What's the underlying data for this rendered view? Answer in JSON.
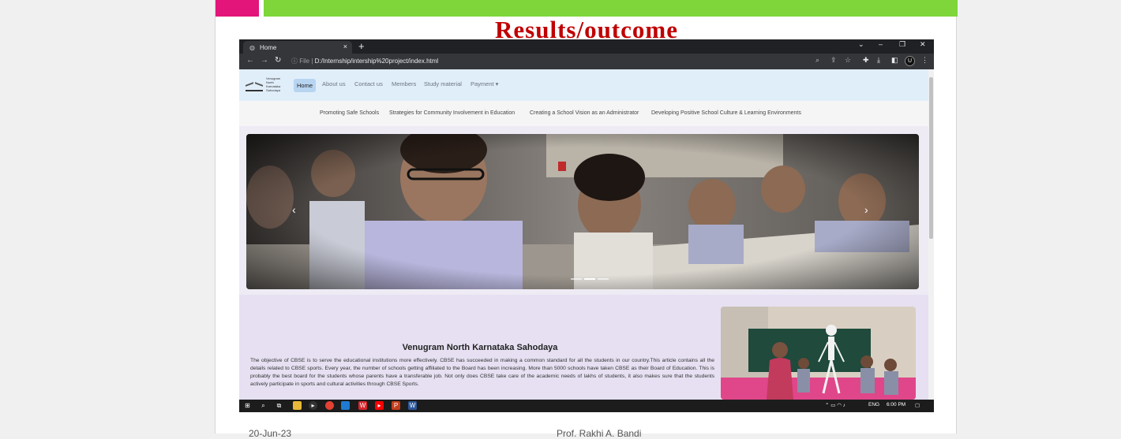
{
  "slide": {
    "title": "Results/outcome",
    "footer_left": "20-Jun-23",
    "footer_right": "Prof. Rakhi A. Bandi",
    "colors": {
      "pink": "#e3157a",
      "green": "#7ed63a",
      "title": "#c00000"
    }
  },
  "browser": {
    "tab_title": "Home",
    "tab_icon": "globe-icon",
    "url_prefix": "File  |",
    "url": "D:/Internship/intership%20project/index.html",
    "avatar_letter": "U"
  },
  "site": {
    "logo_lines": [
      "Venugram",
      "North",
      "Karnataka",
      "Sahodaya"
    ],
    "nav": {
      "home": "Home",
      "about": "About us",
      "contact": "Contact us",
      "members": "Members",
      "study": "Study material",
      "payment": "Payment ▾"
    },
    "subnav": [
      "Promoting Safe Schools",
      "Strategies for Community Involvement in Education",
      "Creating a School Vision as an Administrator",
      "Developing Positive School Culture & Learning Environments"
    ],
    "carousel": {
      "prev": "‹",
      "next": "›",
      "slides": 3,
      "active": 1
    },
    "about": {
      "title": "Venugram North Karnataka Sahodaya",
      "text": "The objective of CBSE is to serve the educational institutions more effectively. CBSE has succeeded in making a common standard for all the students in our country.This article contains all the details related to CBSE sports. Every year, the number of schools getting affiliated to the Board has been increasing. More than 5000 schools have taken CBSE as their Board of Education. This is probably the best board for the students whose parents have a transferable job. Not only does CBSE take care of the academic needs of lakhs of students, it also makes sure that the students actively participate in sports and cultural activities through CBSE Sports."
    }
  },
  "taskbar": {
    "lang": "ENG",
    "time": "6:00 PM"
  }
}
